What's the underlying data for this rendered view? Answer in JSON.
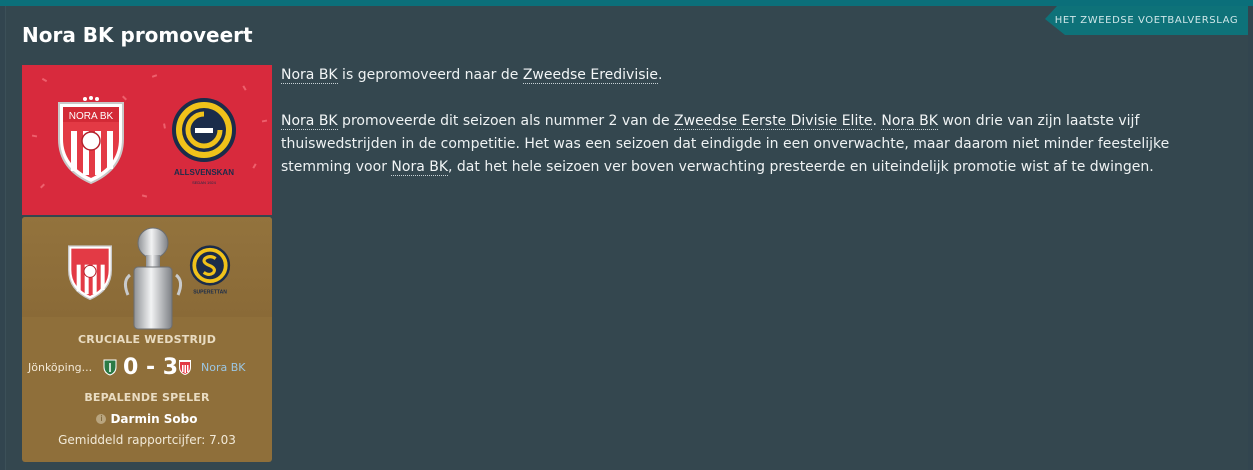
{
  "source_tag": "HET ZWEEDSE VOETBALVERSLAG",
  "title": "Nora BK promoveert",
  "banner": {
    "club_crest_text": "NORA BK",
    "league_text": "ALLSVENSKAN",
    "league_sub": "SEDAN 1924"
  },
  "match_card": {
    "cup_logo_text": "SUPERETTAN",
    "section_label": "CRUCIALE WEDSTRIJD",
    "home_team": "Jönköping...",
    "score": "0 - 3",
    "away_team": "Nora BK",
    "key_player_label": "BEPALENDE SPELER",
    "key_player": "Darmin Sobo",
    "rating_text": "Gemiddeld rapportcijfer: 7.03"
  },
  "article": {
    "p1": {
      "club": "Nora BK",
      "t1": " is gepromoveerd naar de ",
      "league": "Zweedse Eredivisie",
      "t2": "."
    },
    "p2": {
      "club1": "Nora BK",
      "t1": " promoveerde dit seizoen als nummer 2 van de ",
      "league": "Zweedse Eerste Divisie Elite",
      "t2": ". ",
      "club2": "Nora BK",
      "t3": " won drie van zijn laatste vijf thuiswedstrijden in de competitie. Het was een seizoen dat eindigde in een onverwachte, maar daarom niet minder feestelijke stemming voor ",
      "club3": "Nora BK",
      "t4": ", dat het hele seizoen ver boven verwachting presteerde en uiteindelijk promotie wist af te dwingen."
    }
  },
  "colors": {
    "background": "#32454f",
    "accent_teal": "#0e7279",
    "banner_red": "#d82a3d",
    "card_gold": "#8f6f3a",
    "away_team_blue": "#9cc6e2"
  },
  "icons": [
    "nora-bk-crest-icon",
    "allsvenskan-logo-icon",
    "superettan-logo-icon",
    "trophy-icon",
    "info-icon"
  ]
}
